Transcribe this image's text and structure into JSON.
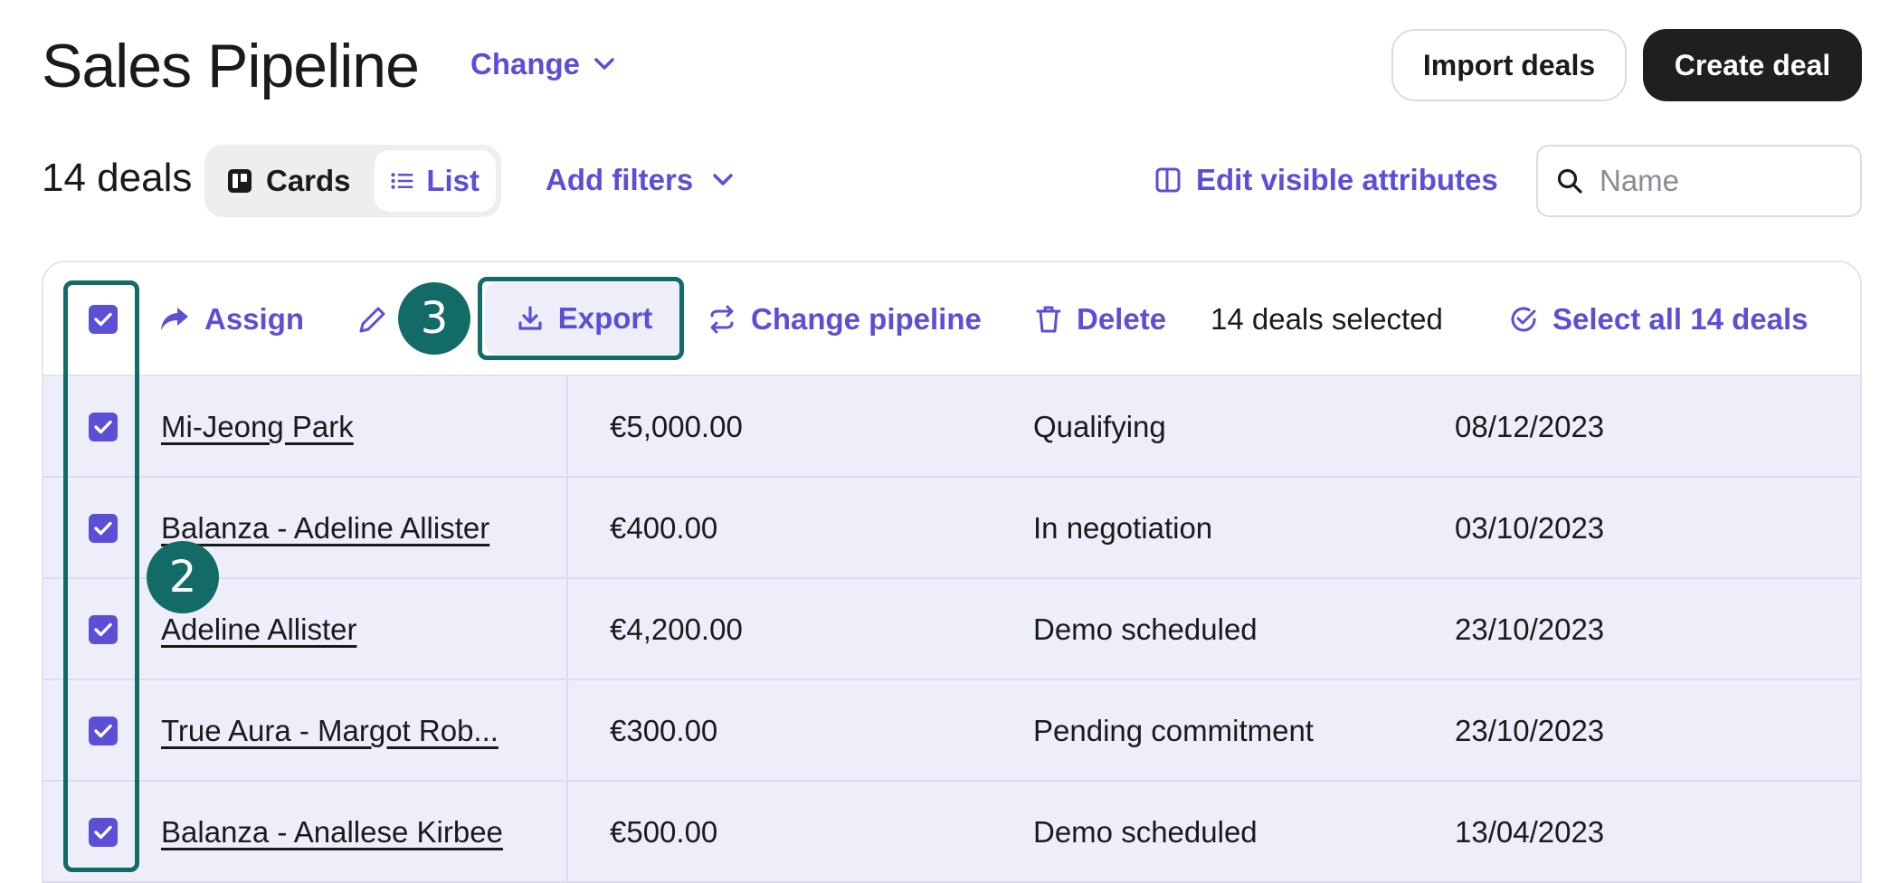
{
  "header": {
    "title": "Sales Pipeline",
    "change_label": "Change",
    "import_label": "Import deals",
    "create_label": "Create deal"
  },
  "controls": {
    "deals_count": "14 deals",
    "view_cards": "Cards",
    "view_list": "List",
    "active_view": "List",
    "add_filters": "Add filters",
    "edit_attributes": "Edit visible attributes",
    "search_placeholder": "Name"
  },
  "toolbar": {
    "assign": "Assign",
    "export": "Export",
    "change_pipeline": "Change pipeline",
    "delete": "Delete",
    "selected_text": "14 deals selected",
    "select_all": "Select all 14 deals"
  },
  "rows": [
    {
      "name": "Mi-Jeong Park",
      "amount": "€5,000.00",
      "stage": "Qualifying",
      "date": "08/12/2023",
      "checked": true
    },
    {
      "name": "Balanza - Adeline Allister",
      "amount": "€400.00",
      "stage": "In negotiation",
      "date": "03/10/2023",
      "checked": true
    },
    {
      "name": "Adeline Allister",
      "amount": "€4,200.00",
      "stage": "Demo scheduled",
      "date": "23/10/2023",
      "checked": true
    },
    {
      "name": "True Aura - Margot Rob...",
      "amount": "€300.00",
      "stage": "Pending commitment",
      "date": "23/10/2023",
      "checked": true
    },
    {
      "name": "Balanza - Anallese Kirbee",
      "amount": "€500.00",
      "stage": "Demo scheduled",
      "date": "13/04/2023",
      "checked": true
    }
  ],
  "annotations": {
    "step_2": "2",
    "step_3": "3"
  },
  "colors": {
    "accent": "#5b4fd6",
    "row_selected_bg": "#eeeefb",
    "annotation": "#136b68",
    "dark_button": "#1f1f1f"
  }
}
